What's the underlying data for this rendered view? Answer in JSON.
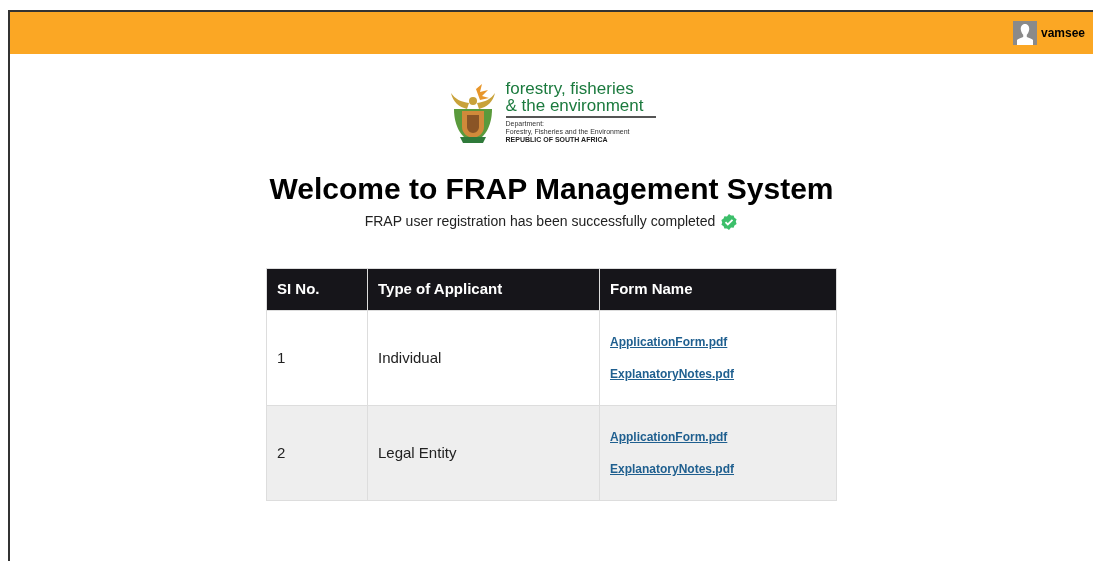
{
  "header": {
    "user_name": "vamsee"
  },
  "logo": {
    "title_lines": [
      "forestry, fisheries",
      "& the environment"
    ],
    "department_label": "Department:",
    "department_name": "Forestry, Fisheries and the Environment",
    "country": "REPUBLIC OF SOUTH AFRICA"
  },
  "heading": "Welcome to FRAP Management System",
  "message": "FRAP user registration has been successfully completed",
  "table": {
    "columns": [
      "SI No.",
      "Type of Applicant",
      "Form Name"
    ],
    "rows": [
      {
        "number": "1",
        "applicant_type": "Individual",
        "forms": [
          "ApplicationForm.pdf",
          "ExplanatoryNotes.pdf"
        ]
      },
      {
        "number": "2",
        "applicant_type": "Legal Entity",
        "forms": [
          "ApplicationForm.pdf",
          "ExplanatoryNotes.pdf"
        ]
      }
    ]
  }
}
